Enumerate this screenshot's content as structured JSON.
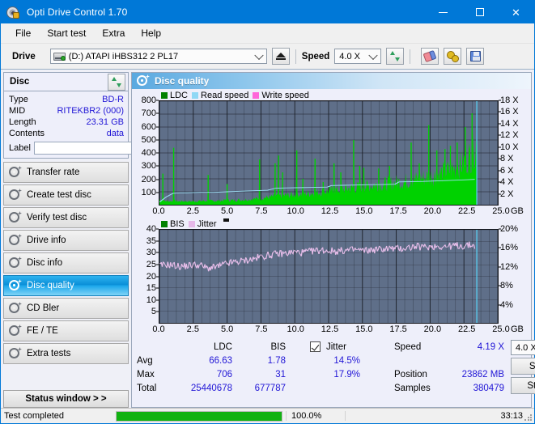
{
  "window": {
    "title": "Opti Drive Control 1.70",
    "icon": "disc-icon",
    "minimize": "–",
    "maximize": "□",
    "close": "×"
  },
  "menu": {
    "items": [
      "File",
      "Start test",
      "Extra",
      "Help"
    ]
  },
  "toolbar": {
    "drive_label": "Drive",
    "drive_value": "(D:)  ATAPI iHBS312  2 PL17",
    "eject_icon": "eject-icon",
    "speed_label": "Speed",
    "speed_value": "4.0 X",
    "refresh_icon": "refresh-icon",
    "erase_icon": "eraser-icon",
    "settings_icon": "gears-icon",
    "save_icon": "floppy-save-icon"
  },
  "disc_panel": {
    "title": "Disc",
    "refresh_icon": "refresh-icon",
    "rows": [
      {
        "key": "Type",
        "value": "BD-R"
      },
      {
        "key": "MID",
        "value": "RITEKBR2 (000)"
      },
      {
        "key": "Length",
        "value": "23.31 GB"
      },
      {
        "key": "Contents",
        "value": "data"
      }
    ],
    "label_key": "Label",
    "label_value": "",
    "label_placeholder": "",
    "disc_icon": "cd-icon"
  },
  "sidebar": {
    "items": [
      {
        "label": "Transfer rate",
        "icon": "disc-test-icon",
        "active": false
      },
      {
        "label": "Create test disc",
        "icon": "disc-test-icon",
        "active": false
      },
      {
        "label": "Verify test disc",
        "icon": "disc-test-icon",
        "active": false
      },
      {
        "label": "Drive info",
        "icon": "disc-test-icon",
        "active": false
      },
      {
        "label": "Disc info",
        "icon": "disc-test-icon",
        "active": false
      },
      {
        "label": "Disc quality",
        "icon": "disc-test-icon",
        "active": true
      },
      {
        "label": "CD Bler",
        "icon": "disc-test-icon",
        "active": false
      },
      {
        "label": "FE / TE",
        "icon": "disc-test-icon",
        "active": false
      },
      {
        "label": "Extra tests",
        "icon": "disc-test-icon",
        "active": false
      }
    ],
    "status_window_button": "Status window > >"
  },
  "panel": {
    "title": "Disc quality",
    "icon": "disc-quality-icon"
  },
  "chart_data": [
    {
      "type": "area",
      "name": "ldc-chart",
      "title": "",
      "legend": [
        {
          "label": "LDC",
          "color": "#008000"
        },
        {
          "label": "Read speed",
          "color": "#8fd8f5"
        },
        {
          "label": "Write speed",
          "color": "#ff66d9"
        }
      ],
      "legend_position": "top-left",
      "grid": true,
      "xlabel": "GB",
      "ylabel": "",
      "xlim": [
        0,
        25
      ],
      "ylim": [
        0,
        800
      ],
      "y2lim": [
        0,
        18
      ],
      "y2label": "X",
      "xticks": [
        "0.0",
        "2.5",
        "5.0",
        "7.5",
        "10.0",
        "12.5",
        "15.0",
        "17.5",
        "20.0",
        "22.5",
        "25.0"
      ],
      "yticks": [
        100,
        200,
        300,
        400,
        500,
        600,
        700,
        800
      ],
      "y2ticks": [
        "2 X",
        "4 X",
        "6 X",
        "8 X",
        "10 X",
        "12 X",
        "14 X",
        "16 X",
        "18 X"
      ],
      "series": [
        {
          "name": "LDC",
          "color": "#00d200",
          "kind": "area",
          "x": [
            0.0,
            0.3,
            0.6,
            0.9,
            1.2,
            1.5,
            1.8,
            2.1,
            2.4,
            2.7,
            3.0,
            3.3,
            3.6,
            3.9,
            4.2,
            4.5,
            4.8,
            5.1,
            5.4,
            5.7,
            6.0,
            6.3,
            6.6,
            6.9,
            7.2,
            7.5,
            7.8,
            8.1,
            8.4,
            8.7,
            9.0,
            9.3,
            9.6,
            9.9,
            10.2,
            10.5,
            10.8,
            11.1,
            11.4,
            11.7,
            12.0,
            12.3,
            12.6,
            12.9,
            13.2,
            13.5,
            13.8,
            14.1,
            14.4,
            14.7,
            15.0,
            15.3,
            15.6,
            15.9,
            16.2,
            16.5,
            16.8,
            17.1,
            17.4,
            17.7,
            18.0,
            18.3,
            18.6,
            18.9,
            19.2,
            19.5,
            19.8,
            20.1,
            20.4,
            20.7,
            21.0,
            21.3,
            21.6,
            21.9,
            22.2,
            22.5,
            22.8,
            23.1,
            23.4
          ],
          "values": [
            40,
            30,
            28,
            28,
            30,
            26,
            28,
            26,
            26,
            28,
            28,
            30,
            28,
            30,
            30,
            32,
            34,
            36,
            34,
            36,
            38,
            40,
            42,
            44,
            48,
            50,
            55,
            58,
            62,
            66,
            68,
            72,
            74,
            78,
            80,
            84,
            86,
            88,
            92,
            96,
            100,
            104,
            108,
            112,
            116,
            120,
            124,
            128,
            132,
            136,
            140,
            144,
            148,
            152,
            156,
            160,
            164,
            168,
            172,
            176,
            180,
            184,
            190,
            196,
            202,
            208,
            214,
            222,
            230,
            240,
            250,
            262,
            275,
            290,
            308,
            330,
            360,
            400,
            470
          ],
          "spikes": [
            {
              "x": 0.25,
              "y": 240
            },
            {
              "x": 1.05,
              "y": 440
            },
            {
              "x": 3.6,
              "y": 230
            },
            {
              "x": 5.0,
              "y": 160
            },
            {
              "x": 7.4,
              "y": 350
            },
            {
              "x": 8.55,
              "y": 320
            },
            {
              "x": 8.8,
              "y": 380
            },
            {
              "x": 9.1,
              "y": 250
            },
            {
              "x": 10.15,
              "y": 420
            },
            {
              "x": 10.6,
              "y": 200
            },
            {
              "x": 11.5,
              "y": 355
            },
            {
              "x": 12.1,
              "y": 175
            },
            {
              "x": 12.9,
              "y": 320
            },
            {
              "x": 13.4,
              "y": 250
            },
            {
              "x": 14.35,
              "y": 500
            },
            {
              "x": 14.8,
              "y": 300
            },
            {
              "x": 15.1,
              "y": 285
            },
            {
              "x": 16.2,
              "y": 280
            },
            {
              "x": 17.0,
              "y": 300
            },
            {
              "x": 18.6,
              "y": 480
            },
            {
              "x": 19.2,
              "y": 320
            },
            {
              "x": 19.9,
              "y": 615
            },
            {
              "x": 20.5,
              "y": 420
            },
            {
              "x": 21.1,
              "y": 430
            },
            {
              "x": 21.5,
              "y": 455
            },
            {
              "x": 22.0,
              "y": 480
            },
            {
              "x": 22.6,
              "y": 600
            },
            {
              "x": 23.1,
              "y": 706
            }
          ]
        },
        {
          "name": "Read speed",
          "color": "#9fe0f7",
          "kind": "line",
          "x": [
            0.0,
            0.5,
            1.0,
            1.5,
            2.0,
            3.0,
            4.0,
            5.0,
            6.0,
            7.0,
            8.0,
            8.6,
            9.5,
            10.5,
            11.5,
            12.4,
            12.7,
            13.5,
            14.5,
            15.3,
            16.5,
            17.4,
            17.7,
            18.5,
            19.5,
            20.5,
            21.5,
            22.5,
            23.3
          ],
          "values": [
            20,
            60,
            88,
            92,
            92,
            96,
            96,
            100,
            104,
            108,
            112,
            128,
            130,
            132,
            134,
            136,
            148,
            150,
            152,
            154,
            156,
            158,
            176,
            178,
            180,
            184,
            188,
            192,
            196
          ]
        },
        {
          "name": "cursor",
          "color": "#58d2f5",
          "kind": "vline",
          "x": 23.45
        }
      ]
    },
    {
      "type": "area",
      "name": "bis-jitter-chart",
      "title": "",
      "legend": [
        {
          "label": "BIS",
          "color": "#008000"
        },
        {
          "label": "Jitter",
          "color": "#e5b8e8"
        }
      ],
      "legend_position": "top-left",
      "grid": true,
      "xlabel": "GB",
      "ylabel": "",
      "xlim": [
        0,
        25
      ],
      "ylim": [
        0,
        40
      ],
      "y2lim": [
        0,
        20
      ],
      "y2label": "%",
      "xticks": [
        "0.0",
        "2.5",
        "5.0",
        "7.5",
        "10.0",
        "12.5",
        "15.0",
        "17.5",
        "20.0",
        "22.5",
        "25.0"
      ],
      "yticks": [
        5,
        10,
        15,
        20,
        25,
        30,
        35,
        40
      ],
      "y2ticks": [
        "4%",
        "8%",
        "12%",
        "16%",
        "20%"
      ],
      "series": [
        {
          "name": "BIS",
          "kind": "area-gradient",
          "gradient": [
            {
              "x": 0.0,
              "color": "#00c000"
            },
            {
              "x": 12.0,
              "color": "#7ad400"
            },
            {
              "x": 17.0,
              "color": "#d8d800"
            },
            {
              "x": 21.0,
              "color": "#f0a000"
            },
            {
              "x": 23.4,
              "color": "#e06a10"
            }
          ],
          "x": [
            0.0,
            0.5,
            1.0,
            1.5,
            2.0,
            2.5,
            3.0,
            3.5,
            4.0,
            4.5,
            5.0,
            5.5,
            6.0,
            6.5,
            7.0,
            7.5,
            8.0,
            8.5,
            9.0,
            9.5,
            10.0,
            10.5,
            11.0,
            11.5,
            12.0,
            12.5,
            13.0,
            13.5,
            14.0,
            14.5,
            15.0,
            15.5,
            16.0,
            16.5,
            17.0,
            17.5,
            18.0,
            18.5,
            19.0,
            19.5,
            20.0,
            20.5,
            21.0,
            21.5,
            22.0,
            22.5,
            23.0,
            23.4
          ],
          "values": [
            2,
            2,
            2,
            2,
            2,
            2,
            2,
            2.2,
            2.4,
            2.6,
            2.8,
            3,
            3,
            3.2,
            3.4,
            3.6,
            4.5,
            5,
            5.2,
            5.5,
            6,
            6.2,
            6.5,
            7,
            7.5,
            7.8,
            8,
            8.5,
            9,
            9.2,
            10,
            10.5,
            11,
            11.5,
            11.8,
            12,
            12.5,
            13,
            13.5,
            14,
            15,
            16,
            17,
            18.5,
            20,
            22,
            26,
            31
          ],
          "peak_max": 31
        },
        {
          "name": "Jitter",
          "color": "#e6bde9",
          "kind": "line",
          "x": [
            0.0,
            0.5,
            1.0,
            1.5,
            2.0,
            2.5,
            3.0,
            3.5,
            4.0,
            4.5,
            5.0,
            5.5,
            6.0,
            6.5,
            7.0,
            7.5,
            8.0,
            8.5,
            9.0,
            9.5,
            10.0,
            10.5,
            11.0,
            11.5,
            12.0,
            12.5,
            13.0,
            13.5,
            14.0,
            14.5,
            15.0,
            15.5,
            16.0,
            16.5,
            17.0,
            17.5,
            18.0,
            18.5,
            19.0,
            19.5,
            20.0,
            20.5,
            21.0,
            21.5,
            22.0,
            22.5,
            23.0,
            23.3
          ],
          "values": [
            24.5,
            25,
            24.8,
            24.2,
            24.5,
            25,
            24.8,
            23.5,
            23.8,
            24.5,
            25.5,
            26,
            26.5,
            27,
            27.5,
            28.5,
            29,
            29.5,
            29.8,
            30,
            30.5,
            30.2,
            30.5,
            31,
            31.2,
            31,
            30.8,
            31,
            31.2,
            31.5,
            31,
            31.2,
            31.5,
            31.8,
            32,
            31.8,
            32,
            32.5,
            32.8,
            32.5,
            32.8,
            33,
            32.8,
            33,
            33.2,
            33,
            33.5,
            33.2
          ],
          "noise": 1.6
        },
        {
          "name": "cursor",
          "color": "#58d2f5",
          "kind": "vline",
          "x": 23.45
        }
      ]
    }
  ],
  "stats": {
    "columns": [
      "LDC",
      "BIS"
    ],
    "jitter_label": "Jitter",
    "jitter_checked": true,
    "rows": [
      {
        "label": "Avg",
        "ldc": "66.63",
        "bis": "1.78",
        "jitter": "14.5%"
      },
      {
        "label": "Max",
        "ldc": "706",
        "bis": "31",
        "jitter": "17.9%"
      },
      {
        "label": "Total",
        "ldc": "25440678",
        "bis": "677787",
        "jitter": ""
      }
    ],
    "info": [
      {
        "key": "Speed",
        "value": "4.19 X"
      },
      {
        "key": "Position",
        "value": "23862 MB"
      },
      {
        "key": "Samples",
        "value": "380479"
      }
    ],
    "speed_select": "4.0 X",
    "start_full": "Start full",
    "start_part": "Start part"
  },
  "statusbar": {
    "message": "Test completed",
    "progress_percent": 100.0,
    "progress_text": "100.0%",
    "elapsed": "33:13"
  },
  "colors": {
    "accent": "#0078d7",
    "plot_bg": "#5f6f89",
    "ldc_green": "#00d200",
    "read_speed": "#9fe0f7",
    "write_speed": "#ff66d9",
    "jitter_pink": "#e6bde9",
    "value_blue": "#2116d6",
    "progress_green": "#12b212"
  }
}
